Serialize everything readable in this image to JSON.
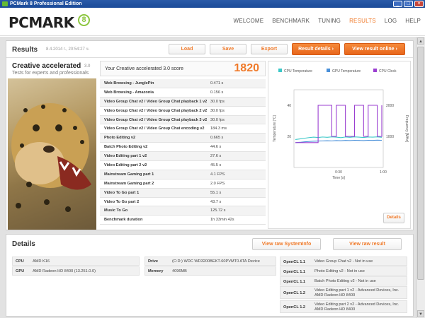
{
  "window": {
    "title": "PCMark 8 Professional Edition"
  },
  "header": {
    "logo_text": "PCMARK",
    "logo_badge": "8",
    "nav": [
      "WELCOME",
      "BENCHMARK",
      "TUNING",
      "RESULTS",
      "LOG",
      "HELP"
    ],
    "active_nav": "RESULTS"
  },
  "results": {
    "title": "Results",
    "date": "8.4.2014 г., 20:54:27 ч.",
    "buttons": {
      "load": "Load",
      "save": "Save",
      "export": "Export",
      "details": "Result details",
      "online": "View result online"
    },
    "test_name": "Creative accelerated",
    "test_sub": "Tests for experts and professionals",
    "test_version": "3.0",
    "score_label": "Your Creative accelerated 3.0 score",
    "score": "1820",
    "rows": [
      {
        "name": "Web Browsing - JunglePin",
        "value": "0.471 s"
      },
      {
        "name": "Web Browsing - Amazonia",
        "value": "0.156 s"
      },
      {
        "name": "Video Group Chat v2 / Video Group Chat playback 1 v2",
        "value": "30.0 fps"
      },
      {
        "name": "Video Group Chat v2 / Video Group Chat playback 2 v2",
        "value": "30.0 fps"
      },
      {
        "name": "Video Group Chat v2 / Video Group Chat playback 3 v2",
        "value": "30.0 fps"
      },
      {
        "name": "Video Group Chat v2 / Video Group Chat encoding v2",
        "value": "184.3 ms"
      },
      {
        "name": "Photo Editing v2",
        "value": "0.665 s"
      },
      {
        "name": "Batch Photo Editing v2",
        "value": "44.6 s"
      },
      {
        "name": "Video Editing part 1 v2",
        "value": "27.6 s"
      },
      {
        "name": "Video Editing part 2 v2",
        "value": "45.5 s"
      },
      {
        "name": "Mainstream Gaming part 1",
        "value": "4.1 FPS"
      },
      {
        "name": "Mainstream Gaming part 2",
        "value": "2.0 FPS"
      },
      {
        "name": "Video To Go part 1",
        "value": "55.1 s"
      },
      {
        "name": "Video To Go part 2",
        "value": "43.7 s"
      },
      {
        "name": "Music To Go",
        "value": "125.72 s"
      },
      {
        "name": "Benchmark duration",
        "value": "1h 33min 42s"
      }
    ],
    "chart_details_label": "Details"
  },
  "chart_data": {
    "type": "line",
    "legend": [
      "CPU Temperature",
      "GPU Temperature",
      "CPU Clock"
    ],
    "legend_placement": "top",
    "colors": [
      "#3cc8c8",
      "#4a90d9",
      "#9b3fd1"
    ],
    "xlabel": "Time [s]",
    "x_ticks": [
      "0:30",
      "1:00"
    ],
    "ylabel_left": "Temperature [°C]",
    "ylabel_right": "Frequency [MHz]",
    "y_left_ticks": [
      20,
      40
    ],
    "y_left_lim": [
      0,
      50
    ],
    "y_right_ticks": [
      1000,
      2000
    ],
    "y_right_lim": [
      0,
      2500
    ],
    "series": [
      {
        "name": "CPU Temperature",
        "axis": "left",
        "values": [
          18,
          18.4,
          18.8,
          19.2,
          19.5,
          19.3,
          19.6,
          19.4,
          19.7,
          19.5,
          19.2,
          19.6,
          19.4,
          19.7,
          19.5,
          19.3,
          19.6,
          19.5,
          19.7,
          19.4
        ]
      },
      {
        "name": "GPU Temperature",
        "axis": "left",
        "values": [
          16,
          16.2,
          16.5,
          16.7,
          16.9,
          17.0,
          17.1,
          17.2,
          17.1,
          17.3,
          17.2,
          17.4,
          17.3,
          17.5,
          17.4,
          17.3,
          17.5,
          17.4,
          17.6,
          17.5
        ]
      },
      {
        "name": "CPU Clock",
        "axis": "right",
        "values": [
          800,
          800,
          800,
          800,
          800,
          2000,
          2000,
          2000,
          1000,
          2000,
          2000,
          1000,
          1000,
          2000,
          2000,
          1000,
          2000,
          2000,
          1000,
          2000
        ]
      }
    ]
  },
  "details": {
    "title": "Details",
    "buttons": {
      "sysinfo": "View raw SystemInfo",
      "rawres": "View raw result"
    },
    "hardware": [
      {
        "label": "CPU",
        "value": "AMD K16"
      },
      {
        "label": "GPU",
        "value": "AMD Radeon HD 8400 (13.251.0.0)"
      },
      {
        "label": "Drive",
        "value": "(C:D:) WDC WD3200BEKT-60PVMT0 ATA Device"
      },
      {
        "label": "Memory",
        "value": "4096MB"
      }
    ],
    "opencl": [
      {
        "label": "OpenCL 1.1",
        "value": "Video Group Chat v2 - Not in use"
      },
      {
        "label": "OpenCL 1.1",
        "value": "Photo Editing v2 - Not in use"
      },
      {
        "label": "OpenCL 1.1",
        "value": "Batch Photo Editing v2 - Not in use"
      },
      {
        "label": "OpenCL 1.2",
        "value": "Video Editing part 1 v2 - Advanced Devices, Inc. AMD Radeon HD 8400"
      },
      {
        "label": "OpenCL 1.2",
        "value": "Video Editing part 2 v2 - Advanced Devices, Inc. AMD Radeon HD 8400"
      }
    ]
  }
}
